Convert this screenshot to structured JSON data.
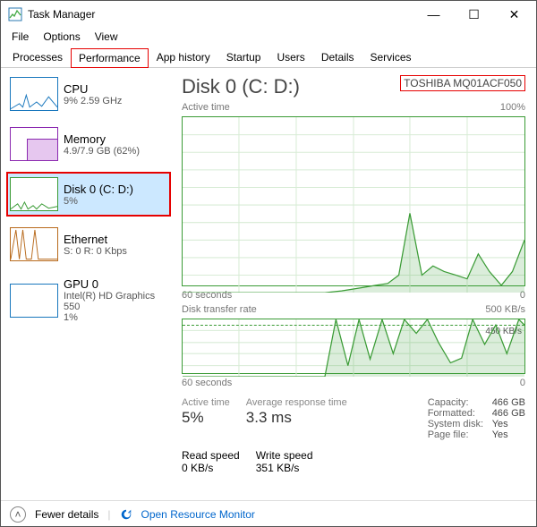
{
  "window": {
    "title": "Task Manager",
    "controls": {
      "min": "—",
      "max": "☐",
      "close": "✕"
    }
  },
  "menu": {
    "file": "File",
    "options": "Options",
    "view": "View"
  },
  "tabs": {
    "processes": "Processes",
    "performance": "Performance",
    "apphistory": "App history",
    "startup": "Startup",
    "users": "Users",
    "details": "Details",
    "services": "Services"
  },
  "sidebar": [
    {
      "name": "CPU",
      "sub": "9%  2.59 GHz"
    },
    {
      "name": "Memory",
      "sub": "4.9/7.9 GB (62%)"
    },
    {
      "name": "Disk 0 (C: D:)",
      "sub": "5%"
    },
    {
      "name": "Ethernet",
      "sub": "S: 0  R: 0 Kbps"
    },
    {
      "name": "GPU 0",
      "sub": "Intel(R) HD Graphics 550\n1%"
    }
  ],
  "main": {
    "title": "Disk 0 (C: D:)",
    "model": "TOSHIBA MQ01ACF050",
    "chart1": {
      "label": "Active time",
      "right": "100%",
      "xL": "60 seconds",
      "xR": "0"
    },
    "chart2": {
      "label": "Disk transfer rate",
      "right": "500 KB/s",
      "dashed": "450 KB/s",
      "xL": "60 seconds",
      "xR": "0"
    },
    "stats": {
      "active": {
        "lbl": "Active time",
        "val": "5%"
      },
      "avg": {
        "lbl": "Average response time",
        "val": "3.3 ms"
      },
      "read": {
        "lbl": "Read speed",
        "val": "0 KB/s"
      },
      "write": {
        "lbl": "Write speed",
        "val": "351 KB/s"
      }
    },
    "info": {
      "capacity": {
        "k": "Capacity:",
        "v": "466 GB"
      },
      "formatted": {
        "k": "Formatted:",
        "v": "466 GB"
      },
      "sysdisk": {
        "k": "System disk:",
        "v": "Yes"
      },
      "pagefile": {
        "k": "Page file:",
        "v": "Yes"
      }
    }
  },
  "footer": {
    "fewer": "Fewer details",
    "orm": "Open Resource Monitor"
  },
  "chart_data": [
    {
      "type": "area",
      "title": "Active time",
      "ylabel": "%",
      "ylim": [
        0,
        100
      ],
      "xlabel": "seconds",
      "xlim": [
        60,
        0
      ],
      "x": [
        60,
        55,
        50,
        45,
        40,
        35,
        32,
        30,
        28,
        26,
        24,
        22,
        20,
        18,
        16,
        14,
        12,
        10,
        8,
        6,
        4,
        2,
        0
      ],
      "values": [
        0,
        0,
        0,
        0,
        0,
        0,
        1,
        2,
        3,
        4,
        5,
        10,
        45,
        10,
        15,
        12,
        10,
        8,
        22,
        12,
        4,
        12,
        30
      ]
    },
    {
      "type": "area",
      "title": "Disk transfer rate",
      "ylabel": "KB/s",
      "ylim": [
        0,
        500
      ],
      "xlabel": "seconds",
      "xlim": [
        60,
        0
      ],
      "annotation": "450 KB/s",
      "x": [
        60,
        50,
        40,
        35,
        33,
        31,
        29,
        27,
        25,
        23,
        21,
        19,
        17,
        15,
        13,
        11,
        9,
        7,
        5,
        3,
        1,
        0
      ],
      "values": [
        0,
        0,
        0,
        0,
        500,
        100,
        500,
        150,
        500,
        200,
        500,
        380,
        500,
        300,
        120,
        160,
        500,
        280,
        450,
        200,
        500,
        450
      ]
    }
  ]
}
